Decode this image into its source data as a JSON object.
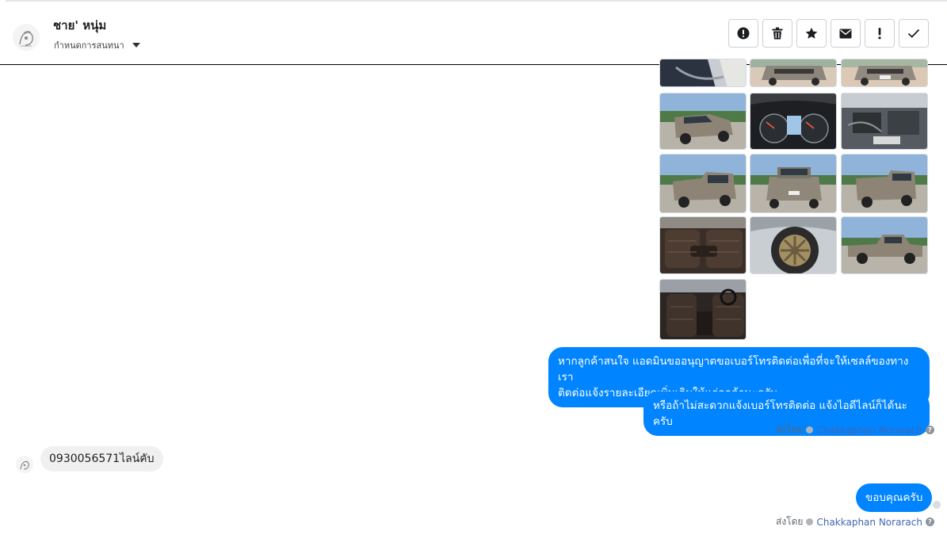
{
  "header": {
    "contact_name": "ชาย' หนุ่ม",
    "assign_label": "กำหนดการสนทนา"
  },
  "toolbar": {
    "buttons": [
      {
        "name": "spam-button",
        "icon": "alert-circle-icon"
      },
      {
        "name": "delete-button",
        "icon": "trash-icon"
      },
      {
        "name": "star-button",
        "icon": "star-icon"
      },
      {
        "name": "mark-unread-button",
        "icon": "envelope-icon"
      },
      {
        "name": "follow-up-button",
        "icon": "exclamation-icon"
      },
      {
        "name": "mark-done-button",
        "icon": "check-icon"
      }
    ]
  },
  "photos": [
    {
      "name": "photo-car-door-interior",
      "kind": "interior"
    },
    {
      "name": "photo-truck-front-1",
      "kind": "road"
    },
    {
      "name": "photo-truck-front-2",
      "kind": "road"
    },
    {
      "name": "photo-truck-front-angle",
      "kind": "road"
    },
    {
      "name": "photo-dashboard-gauges",
      "kind": "dash"
    },
    {
      "name": "photo-engine-bay",
      "kind": "engine"
    },
    {
      "name": "photo-truck-rear-angle",
      "kind": "road"
    },
    {
      "name": "photo-truck-rear",
      "kind": "road"
    },
    {
      "name": "photo-truck-rear-side",
      "kind": "road"
    },
    {
      "name": "photo-rear-seats",
      "kind": "seat"
    },
    {
      "name": "photo-wheel",
      "kind": "wheel"
    },
    {
      "name": "photo-truck-side",
      "kind": "road"
    },
    {
      "name": "photo-front-seats",
      "kind": "seat"
    }
  ],
  "messages": {
    "out1_line1": "หากลูกค้าสนใจ แอดมินขออนุญาตขอเบอร์โทรติดต่อเพื่อที่จะให้เซลล์ของทางเรา",
    "out1_line2": "ติดต่อแจ้งรายละเอียดเพิ่มเติมให้แก่ลูกค้านะครับ",
    "out2": "หรือถ้าไม่สะดวกแจ้งเบอร์โทรติดต่อ แจ้งไอดีไลน์ก็ได้นะครับ",
    "in1": "0930056571ไลน์คับ",
    "out3": "ขอบคุณครับ"
  },
  "sent_by": {
    "prefix": "ส่งโดย",
    "agent": "Chakkaphan Norarach",
    "help": "?"
  },
  "colors": {
    "outgoing_bubble": "#0084ff",
    "incoming_bubble": "#f1f0f0",
    "agent_link": "#4267b2"
  }
}
